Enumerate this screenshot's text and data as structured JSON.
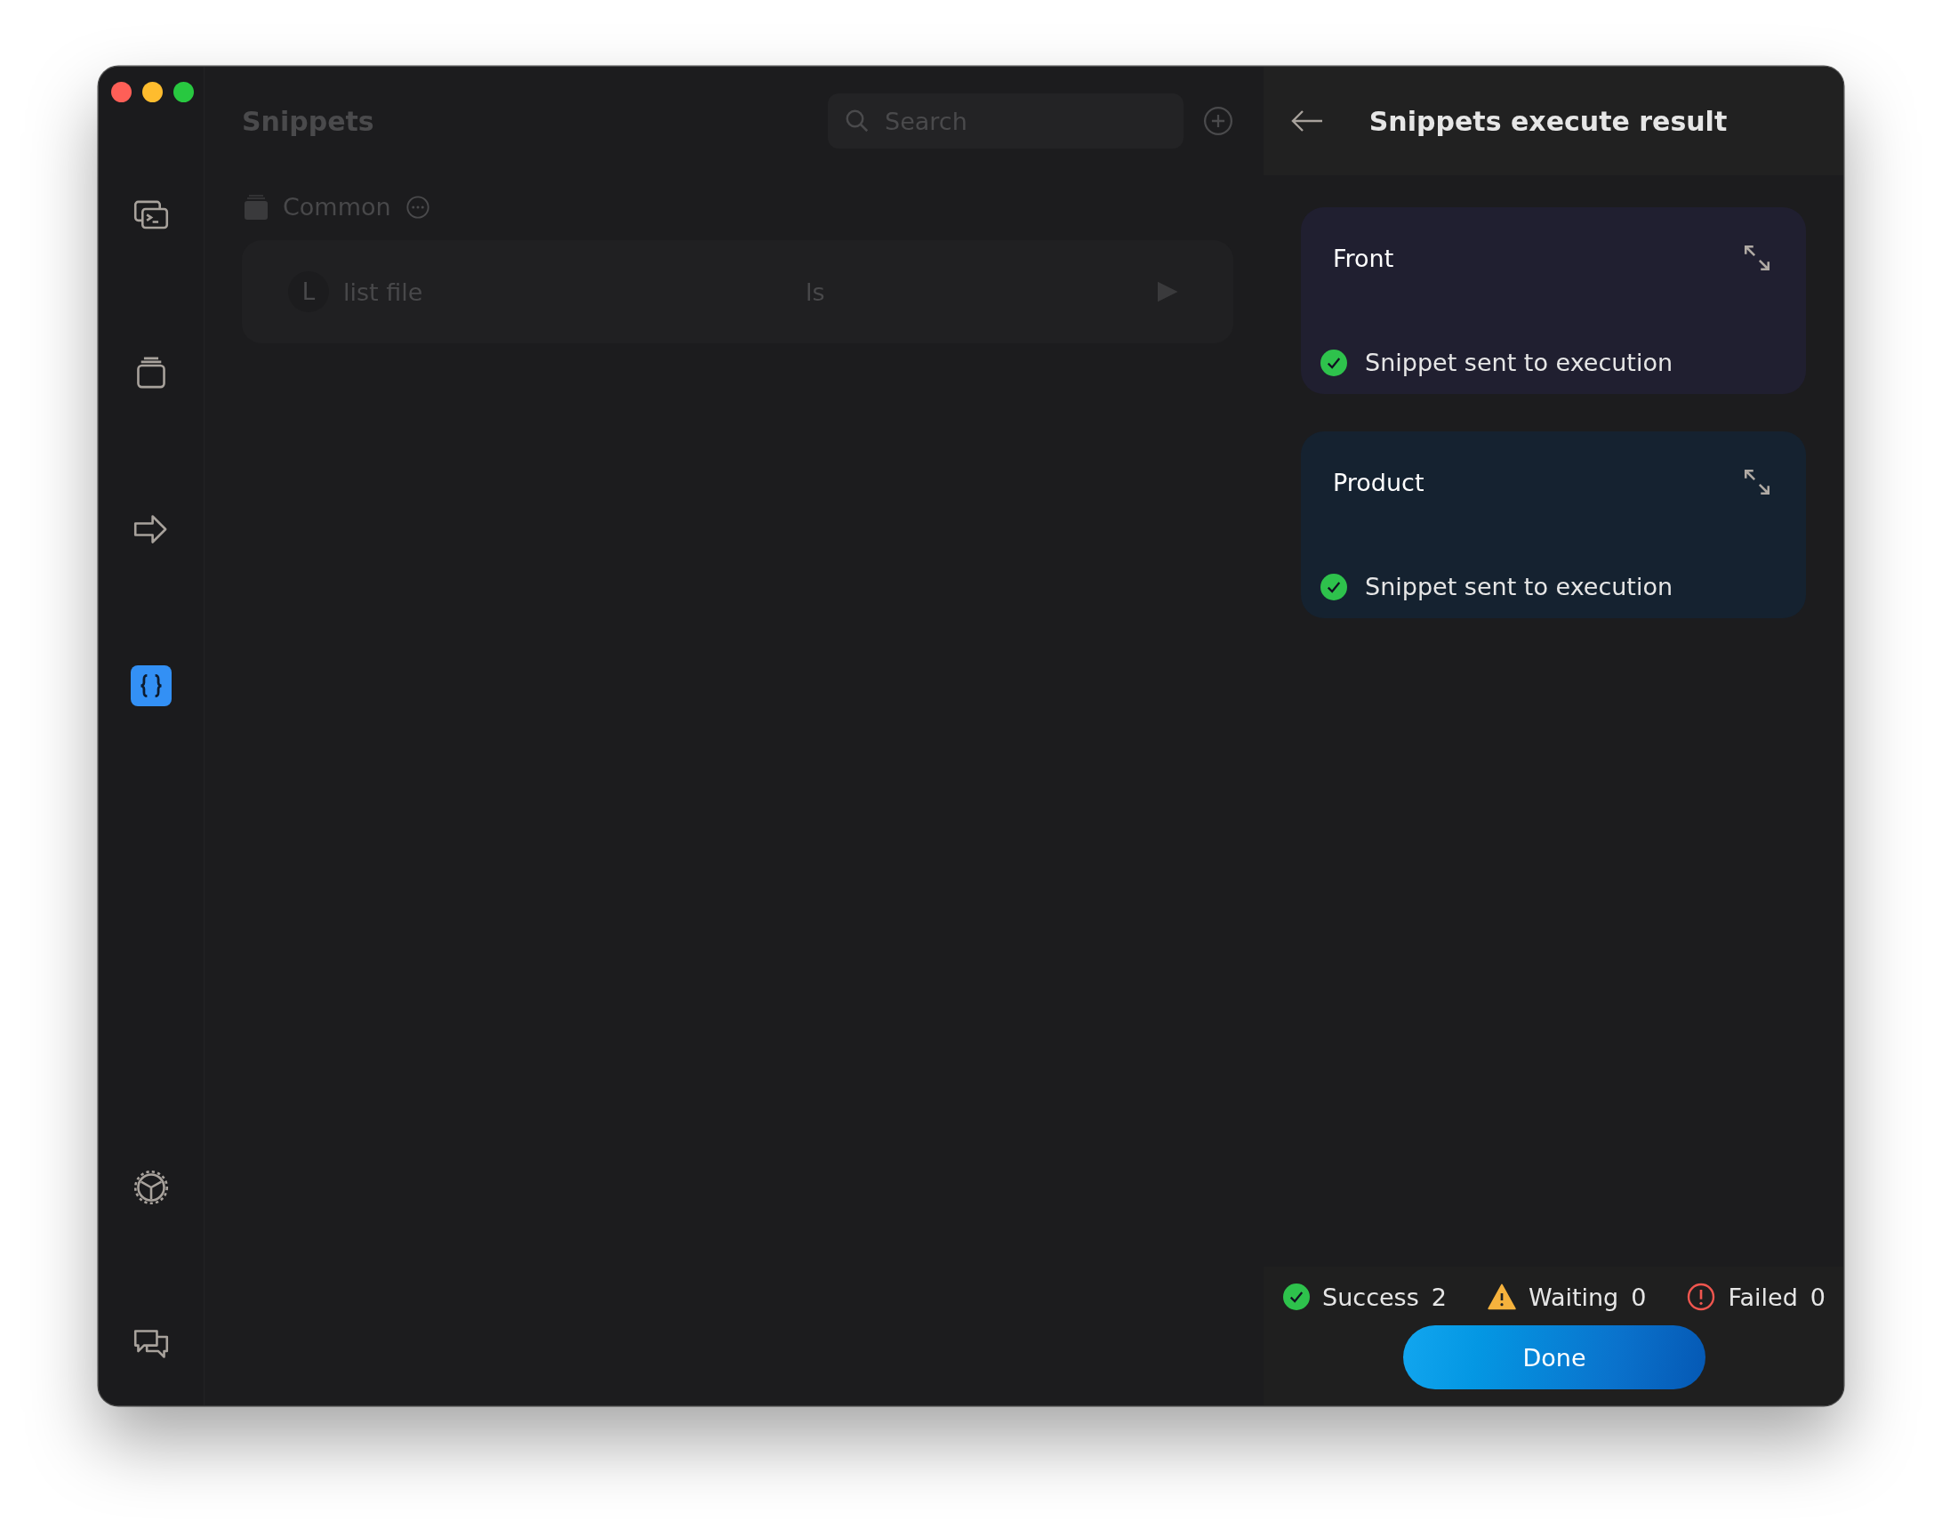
{
  "sidebar": {
    "items": [
      {
        "selected": false
      },
      {
        "selected": false
      },
      {
        "selected": false
      },
      {
        "selected": true
      },
      {
        "selected": false
      },
      {
        "selected": false
      }
    ]
  },
  "snippets": {
    "title": "Snippets",
    "search": {
      "placeholder": "Search"
    },
    "groups": [
      {
        "name": "Common",
        "items": [
          {
            "avatar": "L",
            "name": "list file",
            "command": "ls"
          }
        ]
      }
    ]
  },
  "result_panel": {
    "title": "Snippets execute result",
    "results": [
      {
        "host": "Front",
        "color": "#201f30",
        "kind": "success",
        "message": "Snippet sent to execution"
      },
      {
        "host": "Product",
        "color": "#152230",
        "kind": "success",
        "message": "Snippet sent to execution"
      }
    ],
    "summary": [
      {
        "kind": "success",
        "label": "Success",
        "count": "2"
      },
      {
        "kind": "waiting",
        "label": "Waiting",
        "count": "0"
      },
      {
        "kind": "failed",
        "label": "Failed",
        "count": "0"
      }
    ],
    "done_button": "Done"
  }
}
